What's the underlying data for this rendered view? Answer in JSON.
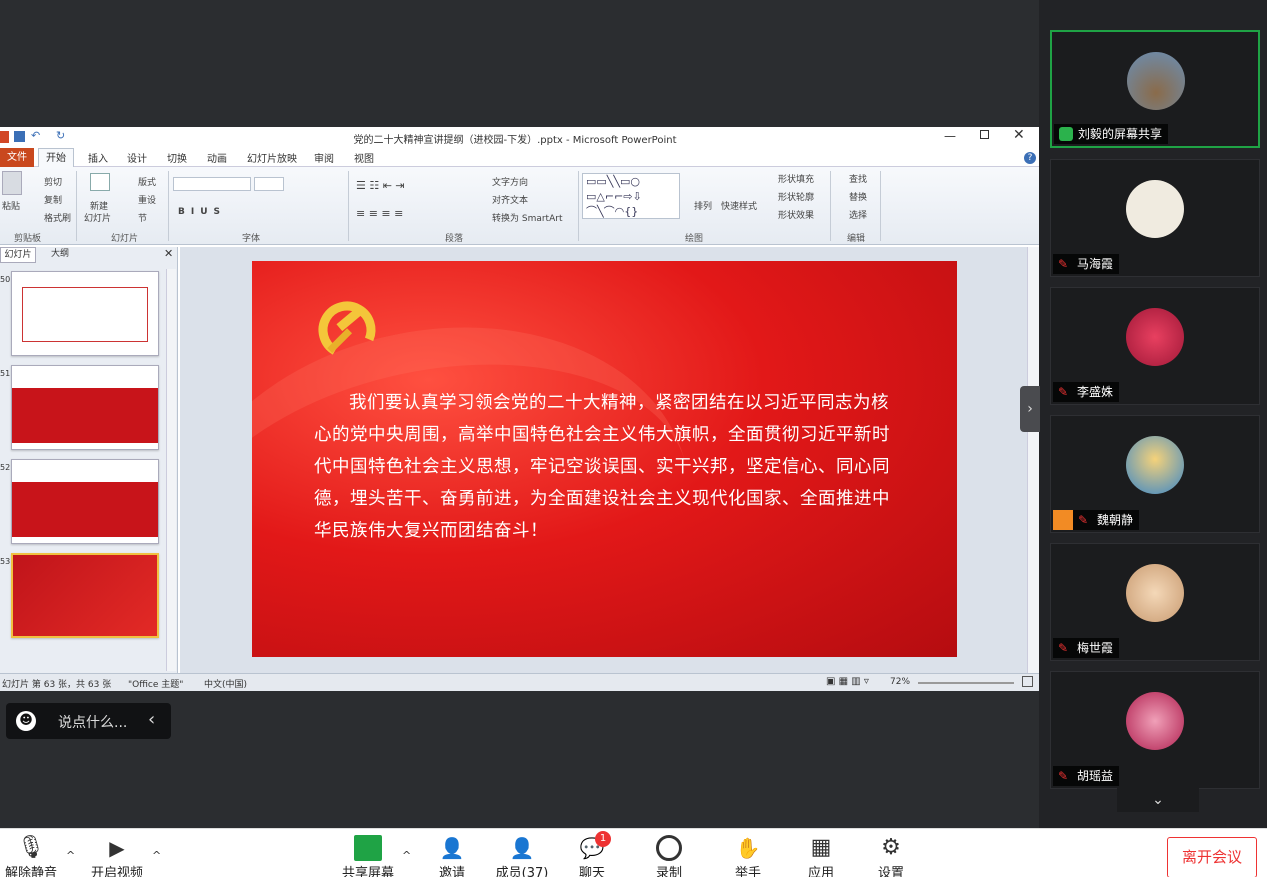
{
  "window": {
    "title": "党的二十大精神宣讲提纲（进校园-下发）.pptx - Microsoft PowerPoint"
  },
  "menu": [
    "文件",
    "开始",
    "插入",
    "设计",
    "切换",
    "动画",
    "幻灯片放映",
    "审阅",
    "视图"
  ],
  "ribbon": {
    "clipboard": {
      "paste": "粘贴",
      "cut": "剪切",
      "copy": "复制",
      "format": "格式刷",
      "label": "剪贴板"
    },
    "slides": {
      "new": "新建",
      "new2": "幻灯片",
      "layout": "版式",
      "reset": "重设",
      "section": "节",
      "label": "幻灯片"
    },
    "font": {
      "label": "字体"
    },
    "para": {
      "textdir": "文字方向",
      "align": "对齐文本",
      "smartart": "转换为 SmartArt",
      "label": "段落"
    },
    "drawing": {
      "arrange": "排列",
      "quick": "快速样式",
      "fill": "形状填充",
      "outline": "形状轮廓",
      "effect": "形状效果",
      "label": "绘图"
    },
    "editing": {
      "find": "查找",
      "replace": "替换",
      "select": "选择",
      "label": "编辑"
    }
  },
  "panel": {
    "tab_slides": "幻灯片",
    "tab_outline": "大纲",
    "nums": [
      "50",
      "51",
      "52",
      "53"
    ]
  },
  "slide": {
    "text": "我们要认真学习领会党的二十大精神，紧密团结在以习近平同志为核心的党中央周围，高举中国特色社会主义伟大旗帜，全面贯彻习近平新时代中国特色社会主义思想，牢记空谈误国、实干兴邦，坚定信心、同心同德，埋头苦干、奋勇前进，为全面建设社会主义现代化国家、全面推进中华民族伟大复兴而团结奋斗！"
  },
  "status": {
    "slide": "幻灯片 第 63 张，共 63 张",
    "theme": "\"Office 主题\"",
    "lang": "中文(中国)",
    "zoom": "72%"
  },
  "chat": {
    "placeholder": "说点什么..."
  },
  "participants": [
    {
      "name": "刘毅的屏幕共享",
      "color": "#6a8fb5"
    },
    {
      "name": "马海霞",
      "color": "#e8e0d0"
    },
    {
      "name": "李盛姝",
      "color": "#d33a55"
    },
    {
      "name": "魏朝静",
      "color": "#e8a53a"
    },
    {
      "name": "梅世霞",
      "color": "#e8c7a0"
    },
    {
      "name": "胡瑶益",
      "color": "#c0305a"
    }
  ],
  "toolbar": {
    "mute": "解除静音",
    "video": "开启视频",
    "share": "共享屏幕",
    "invite": "邀请",
    "members": "成员(37)",
    "chat": "聊天",
    "chat_badge": "1",
    "record": "录制",
    "hand": "举手",
    "apps": "应用",
    "settings": "设置",
    "leave": "离开会议"
  }
}
